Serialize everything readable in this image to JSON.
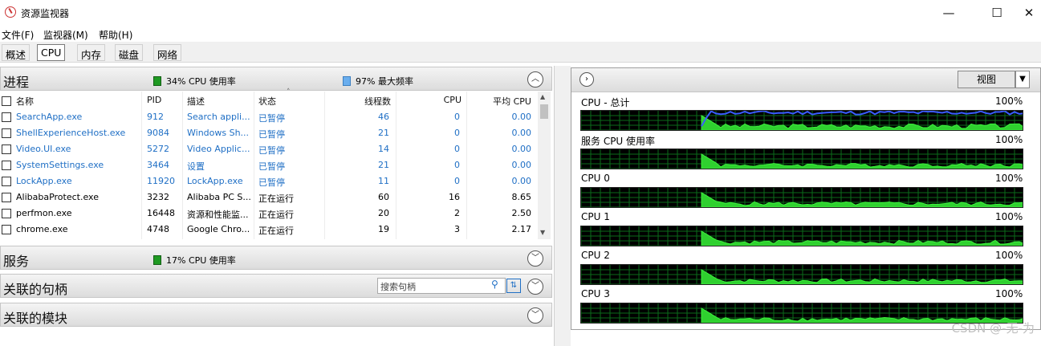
{
  "window": {
    "title": "资源监视器",
    "minimize": "—",
    "maximize": "☐",
    "close": "✕"
  },
  "menu": [
    "文件(F)",
    "监视器(M)",
    "帮助(H)"
  ],
  "tabs": [
    "概述",
    "CPU",
    "内存",
    "磁盘",
    "网络"
  ],
  "processes": {
    "title": "进程",
    "cpu_usage": "34% CPU 使用率",
    "max_freq": "97% 最大频率",
    "headers": [
      "名称",
      "PID",
      "描述",
      "状态",
      "线程数",
      "CPU",
      "平均 CPU"
    ],
    "rows": [
      {
        "name": "SearchApp.exe",
        "pid": "912",
        "desc": "Search appli...",
        "status": "已暂停",
        "threads": "46",
        "cpu": "0",
        "avg": "0.00",
        "suspended": true
      },
      {
        "name": "ShellExperienceHost.exe",
        "pid": "9084",
        "desc": "Windows Sh...",
        "status": "已暂停",
        "threads": "21",
        "cpu": "0",
        "avg": "0.00",
        "suspended": true
      },
      {
        "name": "Video.UI.exe",
        "pid": "5272",
        "desc": "Video Applic...",
        "status": "已暂停",
        "threads": "14",
        "cpu": "0",
        "avg": "0.00",
        "suspended": true
      },
      {
        "name": "SystemSettings.exe",
        "pid": "3464",
        "desc": "设置",
        "status": "已暂停",
        "threads": "21",
        "cpu": "0",
        "avg": "0.00",
        "suspended": true
      },
      {
        "name": "LockApp.exe",
        "pid": "11920",
        "desc": "LockApp.exe",
        "status": "已暂停",
        "threads": "11",
        "cpu": "0",
        "avg": "0.00",
        "suspended": true
      },
      {
        "name": "AlibabaProtect.exe",
        "pid": "3232",
        "desc": "Alibaba PC S...",
        "status": "正在运行",
        "threads": "60",
        "cpu": "16",
        "avg": "8.65",
        "suspended": false
      },
      {
        "name": "perfmon.exe",
        "pid": "16448",
        "desc": "资源和性能监...",
        "status": "正在运行",
        "threads": "20",
        "cpu": "2",
        "avg": "2.50",
        "suspended": false
      },
      {
        "name": "chrome.exe",
        "pid": "4748",
        "desc": "Google Chro...",
        "status": "正在运行",
        "threads": "19",
        "cpu": "3",
        "avg": "2.17",
        "suspended": false
      }
    ]
  },
  "services": {
    "title": "服务",
    "cpu_usage": "17% CPU 使用率"
  },
  "handles": {
    "title": "关联的句柄",
    "search_placeholder": "搜索句柄"
  },
  "modules": {
    "title": "关联的模块"
  },
  "right": {
    "view_label": "视图",
    "graphs": [
      {
        "label": "CPU - 总计",
        "max": "100%"
      },
      {
        "label": "服务 CPU 使用率",
        "max": "100%"
      },
      {
        "label": "CPU 0",
        "max": "100%"
      },
      {
        "label": "CPU 1",
        "max": "100%"
      },
      {
        "label": "CPU 2",
        "max": "100%"
      },
      {
        "label": "CPU 3",
        "max": "100%"
      }
    ]
  },
  "watermark": "CSDN @-无-为"
}
